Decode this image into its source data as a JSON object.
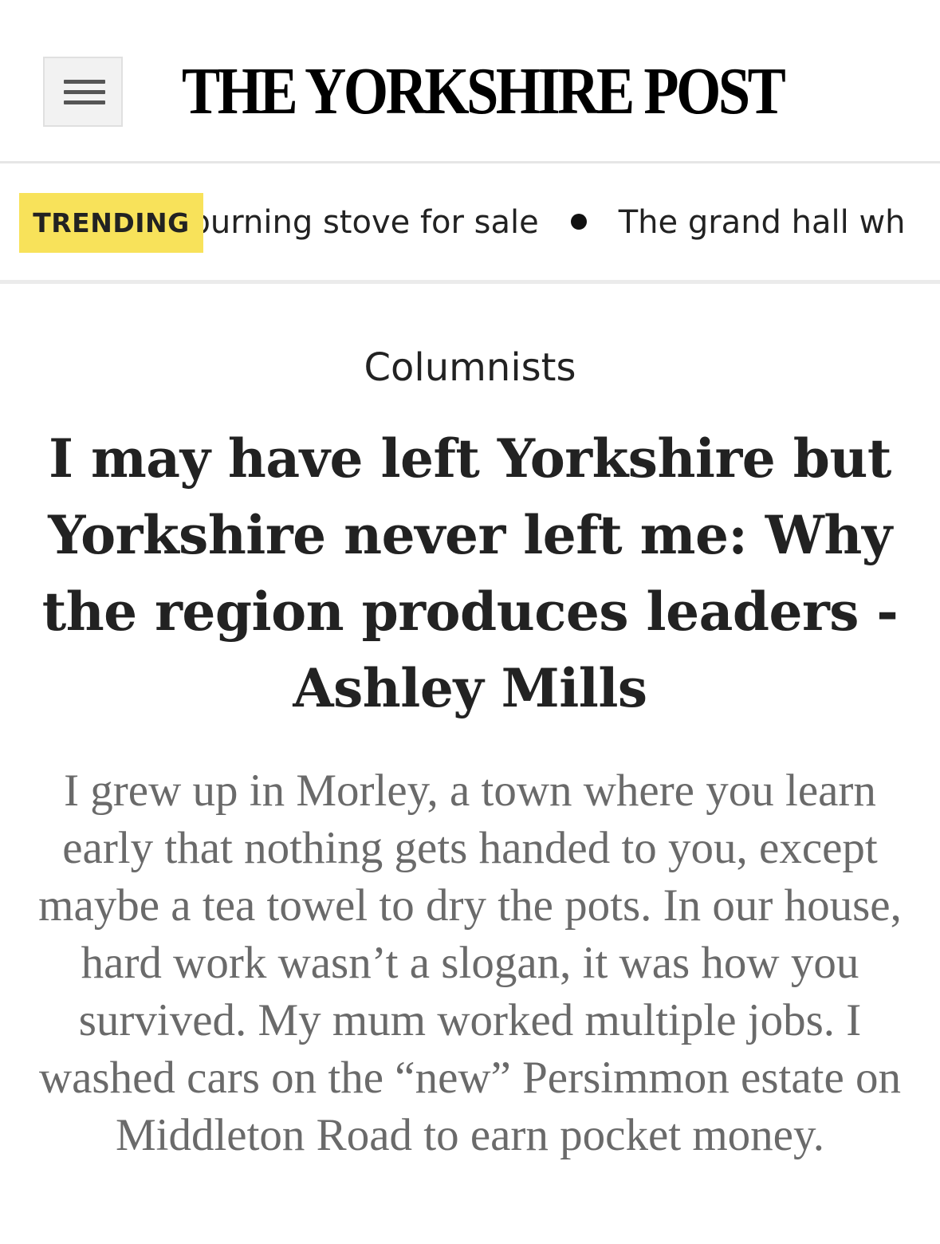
{
  "header": {
    "logo_text": "THE YORKSHIRE POST",
    "menu_icon": "hamburger-menu-icon"
  },
  "trending": {
    "label": "TRENDING",
    "items": [
      "Woodburning stove for sale",
      "The grand hall wh"
    ]
  },
  "article": {
    "section": "Columnists",
    "headline": "I may have left Yorkshire but Yorkshire never left me: Why the region produces leaders - Ashley Mills",
    "standfirst": "I grew up in Morley, a town where you learn early that nothing gets handed to you, except maybe a tea towel to dry the pots. In our house, hard work wasn’t a slogan, it was how you survived. My mum worked multiple jobs. I washed cars on the “new” Persimmon estate on Middleton Road to earn pocket money."
  },
  "colors": {
    "trending_badge": "#f8e25a",
    "headline_text": "#222222",
    "standfirst_text": "#6a6a6a"
  }
}
